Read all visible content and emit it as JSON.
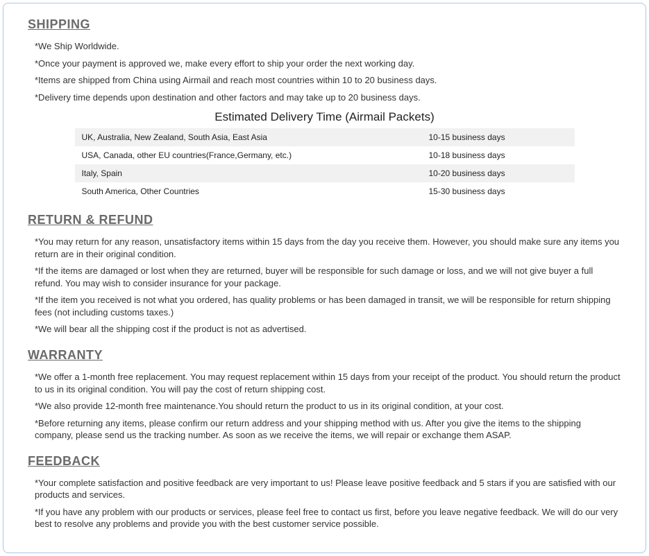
{
  "shipping": {
    "heading": "SHIPPING",
    "bullets": [
      "*We Ship Worldwide.",
      "*Once your payment is approved we, make every effort to ship your order the next working day.",
      "*Items are shipped from China using Airmail and reach most countries within 10 to 20 business days.",
      "*Delivery time depends upon destination and other factors and may take up to 20 business days."
    ],
    "table_title": "Estimated Delivery Time (Airmail Packets)",
    "table": [
      {
        "region": "UK, Australia, New Zealand, South Asia, East Asia",
        "time": "10-15 business days"
      },
      {
        "region": "USA, Canada, other EU countries(France,Germany, etc.)",
        "time": "10-18 business days"
      },
      {
        "region": "Italy, Spain",
        "time": "10-20 business days"
      },
      {
        "region": "South America, Other Countries",
        "time": "15-30 business days"
      }
    ]
  },
  "return": {
    "heading": "RETURN & REFUND",
    "bullets": [
      "*You may return for any reason, unsatisfactory items within 15 days from the day you receive them. However, you should make sure any items you return are in their original condition.",
      "*If the items are damaged or lost when they are returned, buyer will be responsible for such damage or loss, and we will not give buyer a full refund. You may wish to consider insurance for your package.",
      "*If the item you received is not what you ordered, has quality problems or has been damaged in transit, we will be responsible for return shipping fees (not including customs taxes.)",
      "*We will bear all the shipping cost if the product is not as advertised."
    ]
  },
  "warranty": {
    "heading": "WARRANTY",
    "bullets": [
      "*We offer a 1-month free replacement.  You may request replacement within 15 days from your receipt of the product. You should return the product to us in its original condition. You will pay the cost of return shipping cost.",
      "*We also provide 12-month free maintenance.You should return the product to us in its original condition, at your cost.",
      "*Before returning any items, please confirm our return address and your shipping method with us. After you give the items to the shipping company, please send us the tracking number. As soon as we receive the items, we will repair or exchange them ASAP."
    ]
  },
  "feedback": {
    "heading": "FEEDBACK",
    "bullets": [
      "*Your complete satisfaction and positive feedback are very important to us!  Please leave positive feedback and 5 stars if you are satisfied with our products and services.",
      "*If you have any problem with our products or services, please feel free to contact us first, before you leave negative feedback.  We will do our very best to resolve any problems and provide you with the best customer service possible."
    ]
  }
}
